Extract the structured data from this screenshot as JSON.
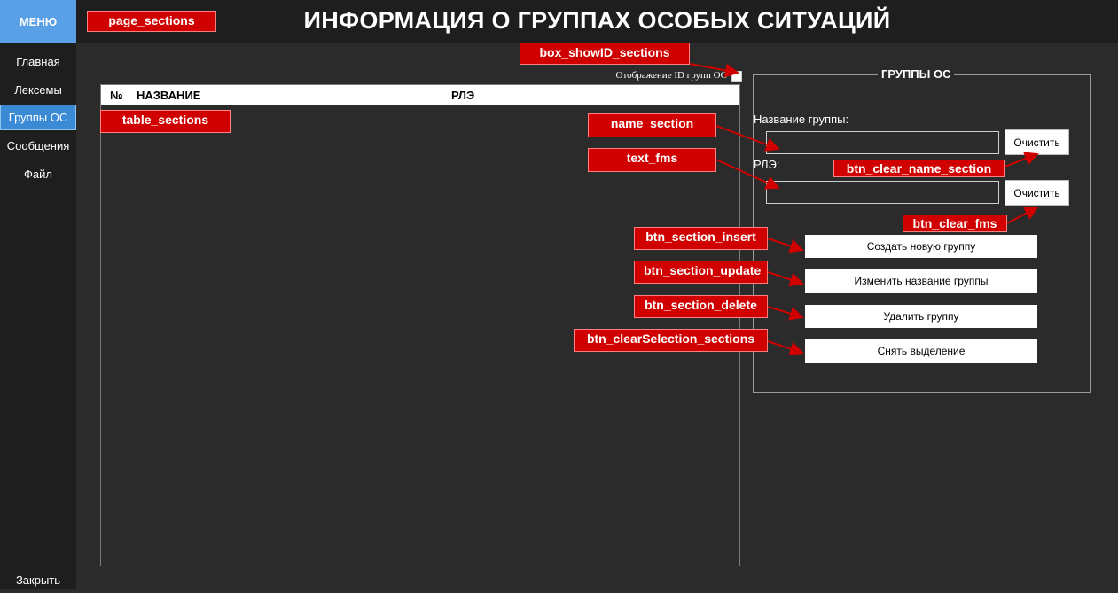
{
  "sidebar": {
    "menu_title": "МЕНЮ",
    "items": [
      {
        "label": "Главная"
      },
      {
        "label": "Лексемы"
      },
      {
        "label": "Группы ОС"
      },
      {
        "label": "Сообщения"
      },
      {
        "label": "Файл"
      }
    ],
    "close_label": "Закрыть"
  },
  "header": {
    "title": "ИНФОРМАЦИЯ О ГРУППАХ ОСОБЫХ СИТУАЦИЙ"
  },
  "table": {
    "columns": [
      "№",
      "НАЗВАНИЕ",
      "РЛЭ"
    ],
    "rows": []
  },
  "show_id": {
    "label": "Отображение ID групп ОС",
    "checked": false
  },
  "group_box": {
    "title": "ГРУППЫ ОС",
    "name_label": "Название группы:",
    "name_value": "",
    "fms_label": "РЛЭ:",
    "fms_value": "",
    "clear_label": "Очистить",
    "clear_label_2": "Очистить",
    "insert_label": "Создать новую группу",
    "update_label": "Изменить название группы",
    "delete_label": "Удалить группу",
    "clear_selection_label": "Снять выделение"
  },
  "annotations": {
    "page_sections": "page_sections",
    "box_showID_sections": "box_showID_sections",
    "table_sections": "table_sections",
    "name_section": "name_section",
    "text_fms": "text_fms",
    "btn_clear_name_section": "btn_clear_name_section",
    "btn_clear_fms": "btn_clear_fms",
    "btn_section_insert": "btn_section_insert",
    "btn_section_update": "btn_section_update",
    "btn_section_delete": "btn_section_delete",
    "btn_clearSelection_sections": "btn_clearSelection_sections"
  },
  "colors": {
    "accent": "#d00000",
    "menu_header": "#5aa0e6",
    "active_item": "#3a8ad6",
    "background": "#2b2b2b"
  }
}
